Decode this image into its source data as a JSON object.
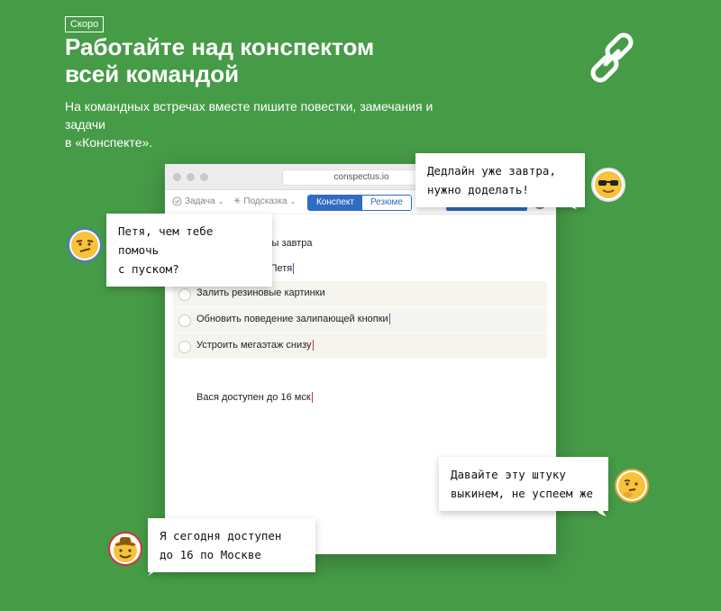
{
  "header": {
    "badge": "Скоро",
    "title_line1": "Работайте над конспектом",
    "title_line2": "всей командой",
    "subtitle_line1": "На командных встречах вместе пишите повестки, замечания и задачи",
    "subtitle_line2": "в «Конспекте»."
  },
  "window": {
    "url": "conspectus.io",
    "toolbar": {
      "task": "Задача",
      "hint": "Подсказка",
      "tab_active": "Конспект",
      "tab_inactive": "Резюме",
      "share": "Поделиться"
    },
    "doc": {
      "line1_visible": "ницы завтра",
      "line2": "Ответственный Петя",
      "tasks": [
        "Залить резиновые картинки",
        "Обновить поведение залипающей кнопки",
        "Устроить мегаэтаж снизу"
      ],
      "note": "Вася доступен до 16 мск"
    }
  },
  "bubbles": {
    "deadline_line1": "Дедлайн уже завтра,",
    "deadline_line2": "нужно доделать!",
    "petya_line1": "Петя, чем тебе помочь",
    "petya_line2": "с пуском?",
    "throw_line1": "Давайте эту штуку",
    "throw_line2": "выкинем, не успеем же",
    "available_line1": "Я сегодня доступен",
    "available_line2": "до 16 по Москве"
  },
  "icons": {
    "link": "link-icon",
    "emoji_cool": "sunglasses-emoji",
    "emoji_smirk": "smirk-emoji",
    "emoji_thinking": "thinking-emoji",
    "emoji_cowboy": "cowboy-emoji"
  },
  "colors": {
    "background": "#469b47",
    "accent": "#2f6cc2",
    "caret_purple": "#8a3ab9",
    "caret_red": "#d0343a",
    "caret_blue": "#2f6cc2"
  }
}
